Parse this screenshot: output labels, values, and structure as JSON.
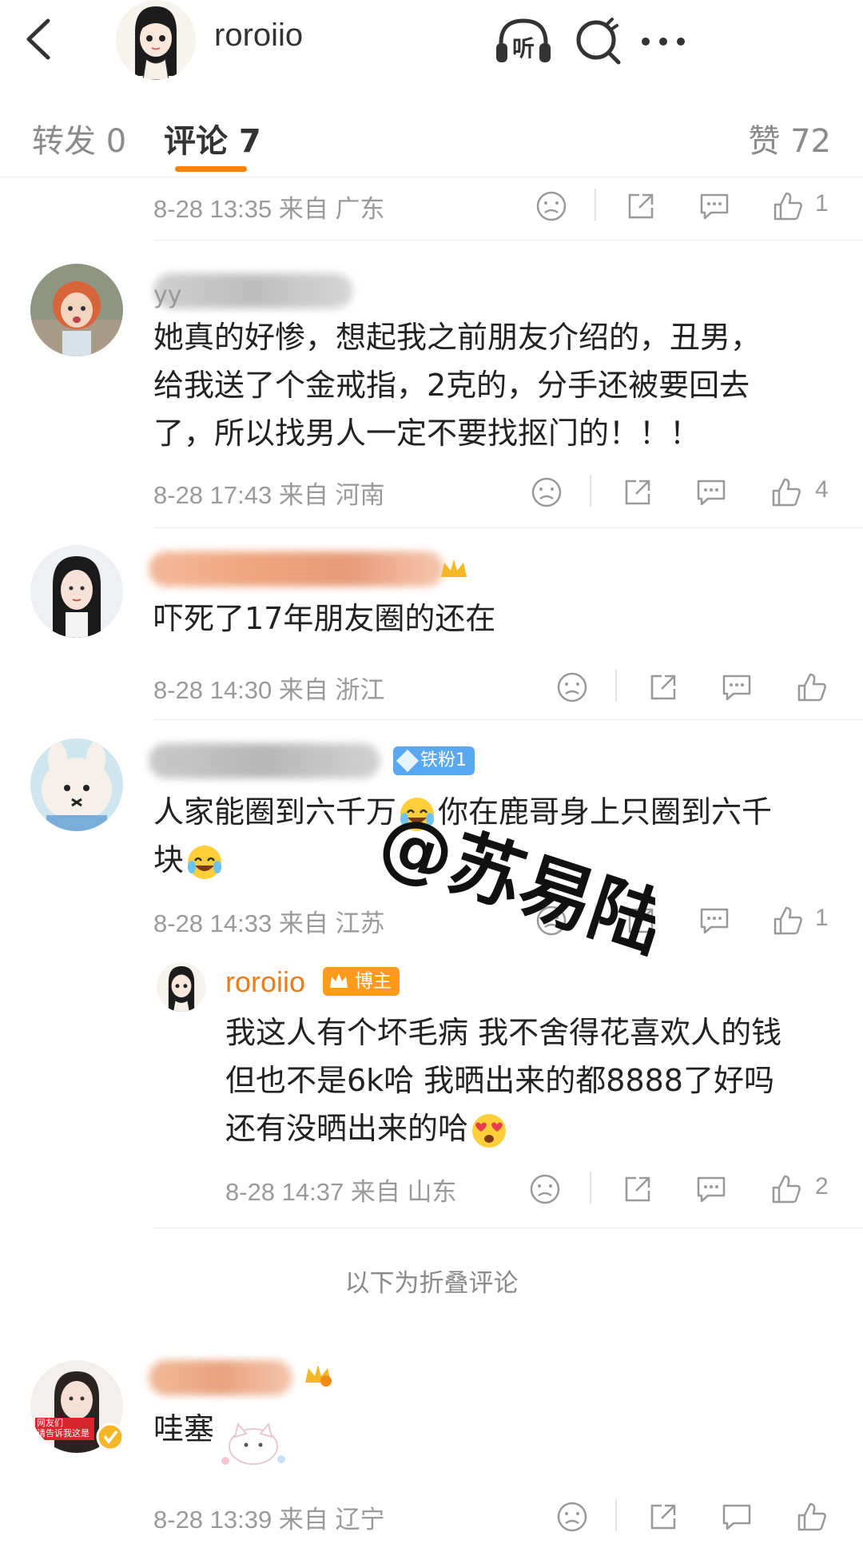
{
  "header": {
    "username": "roroiio",
    "back_icon": "back-chevron-icon",
    "listen_icon": "listen-headphones-icon",
    "listen_label": "听",
    "search_icon": "search-icon",
    "more_icon": "more-dots-icon"
  },
  "tabs": {
    "repost": "转发 0",
    "comments": "评论 7",
    "likes": "赞 72",
    "accent_color": "#ff8200"
  },
  "comments": [
    {
      "meta": "8-28 13:35 来自 广东",
      "likes": "1"
    },
    {
      "username_visible": "yy",
      "text_lines": [
        "她真的好惨，想起我之前朋友介绍的，丑男，",
        "给我送了个金戒指，2克的，分手还被要回去",
        "了，所以找男人一定不要找抠门的！！！"
      ],
      "meta": "8-28 17:43 来自 河南",
      "likes": "4"
    },
    {
      "text_lines": [
        "吓死了17年朋友圈的还在"
      ],
      "meta": "8-28 14:30 来自 浙江",
      "likes": ""
    },
    {
      "badge": "铁粉1",
      "text_line1_a": "人家能圈到六千万",
      "text_line1_b": "你在鹿哥身上只圈到六千",
      "text_line2": "块",
      "meta": "8-28 14:33 来自 江苏",
      "likes": "1",
      "reply": {
        "username": "roroiio",
        "badge": "博主",
        "text_lines": [
          "我这人有个坏毛病 我不舍得花喜欢人的钱",
          "但也不是6k哈 我晒出来的都8888了好吗",
          "还有没晒出来的哈"
        ],
        "meta": "8-28 14:37 来自 山东",
        "likes": "2"
      }
    },
    {
      "text_lines": [
        "哇塞"
      ],
      "meta": "8-28 13:39 来自 辽宁",
      "avatar_caption": [
        "网友们",
        "请告诉我这是"
      ]
    }
  ],
  "folded_label": "以下为折叠评论",
  "watermark": "@苏易陆"
}
